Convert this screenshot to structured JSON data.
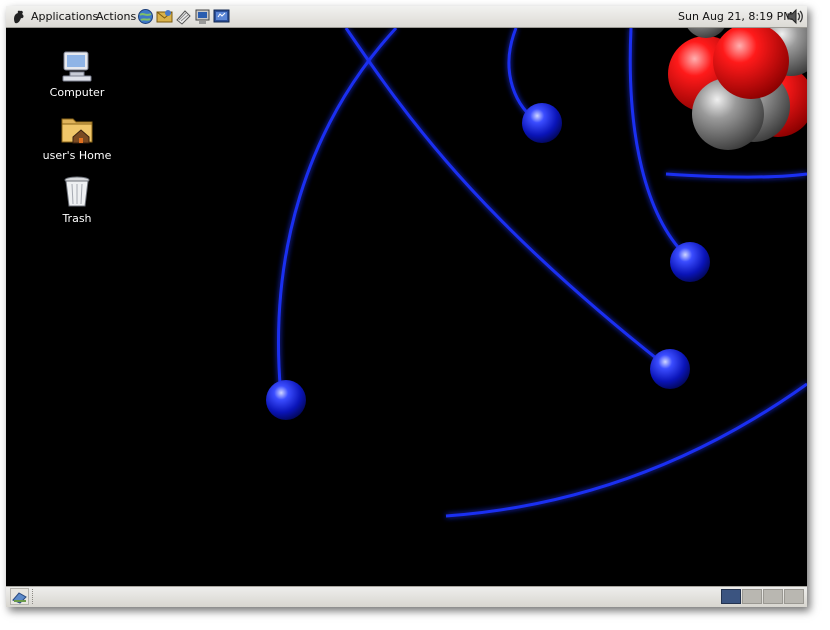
{
  "top_panel": {
    "applications_label": "Applications",
    "actions_label": "Actions",
    "clock": "Sun Aug 21,  8:19 PM",
    "launchers": [
      "web-browser-icon",
      "email-icon",
      "text-editor-icon",
      "terminal-computer-icon",
      "presentation-icon"
    ]
  },
  "desktop": {
    "icons": [
      {
        "label": "Computer",
        "icon": "computer-icon"
      },
      {
        "label": "user's Home",
        "icon": "home-folder-icon"
      },
      {
        "label": "Trash",
        "icon": "trash-icon"
      }
    ],
    "wallpaper": "atom wallpaper: blue orbits and electrons on black with red and grey nucleus"
  },
  "bottom_panel": {
    "workspaces": [
      {
        "name": "workspace-1",
        "active": true
      },
      {
        "name": "workspace-2",
        "active": false
      },
      {
        "name": "workspace-3",
        "active": false
      },
      {
        "name": "workspace-4",
        "active": false
      }
    ]
  },
  "colors": {
    "panel": "#dcdad5",
    "desktop_bg": "#000000",
    "orbit_blue": "#1a2bff",
    "nucleus_red": "#e81010",
    "nucleus_grey": "#8a8a8a",
    "workspace_active": "#3b5480"
  }
}
